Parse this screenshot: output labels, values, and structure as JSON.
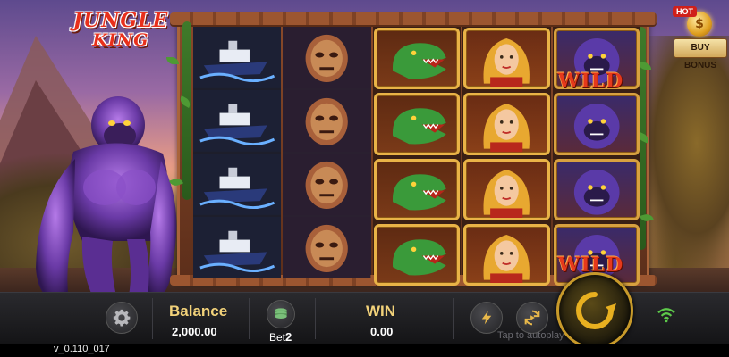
{
  "game": {
    "logo_line1": "JUNGLE",
    "logo_line2": "KING"
  },
  "buy_bonus": {
    "hot_badge": "HOT",
    "coin_symbol": "$",
    "label": "BUY BONUS"
  },
  "reels": {
    "columns": [
      {
        "symbol": "ship",
        "rows": 4
      },
      {
        "symbol": "mask",
        "rows": 4
      },
      {
        "symbol": "t-rex",
        "rows": 4
      },
      {
        "symbol": "woman",
        "rows": 4
      },
      {
        "symbol": "kong-wild",
        "rows": 4
      }
    ],
    "wild_text": "WILD"
  },
  "bottom_bar": {
    "balance_label": "Balance",
    "balance_value": "2,000.00",
    "bet_label": "Bet",
    "bet_value": "2",
    "win_label": "WIN",
    "win_value": "0.00",
    "tap_to_autoplay": "Tap to autoplay"
  },
  "icons": {
    "settings": "gear-icon",
    "bet": "coin-stack-icon",
    "turbo": "lightning-icon",
    "autoplay": "autoplay-icon",
    "spin": "spin-arrow-icon",
    "signal": "wifi-icon"
  },
  "version": "v_0.110_017",
  "colors": {
    "accent_gold": "#f2d27a",
    "frame_wood": "#8a4a2a",
    "wild_red": "#e5391c",
    "wifi_green": "#5dc94a"
  }
}
